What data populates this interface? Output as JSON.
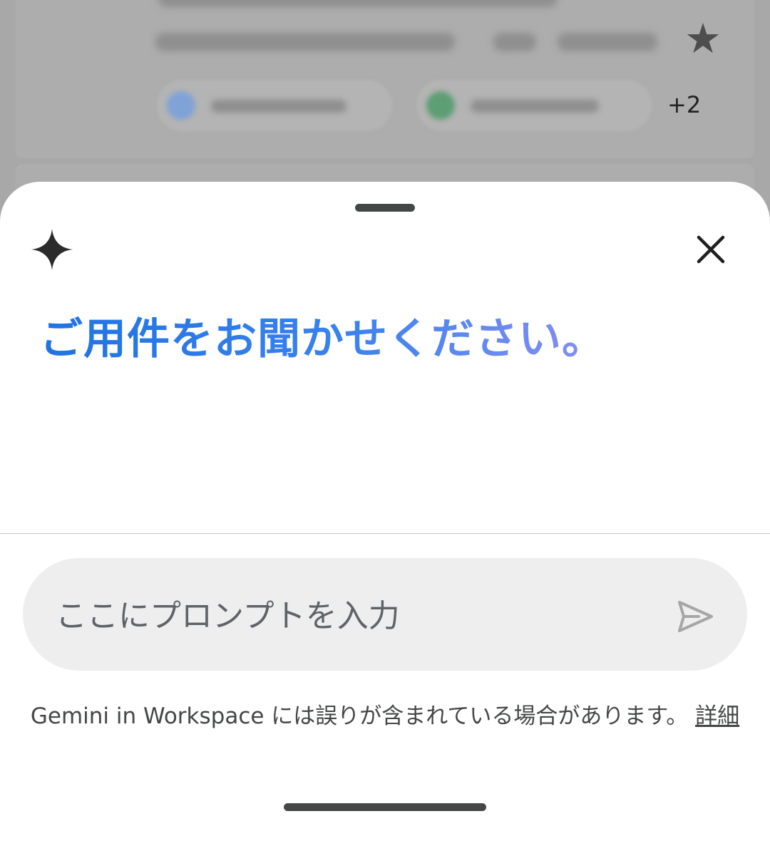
{
  "background": {
    "more_recipients": "+2"
  },
  "sheet": {
    "greeting": "ご用件をお聞かせください。",
    "prompt": {
      "placeholder": "ここにプロンプトを入力",
      "value": ""
    },
    "disclaimer": {
      "text": "Gemini in Workspace には誤りが含まれている場合があります。",
      "link": "詳細"
    }
  },
  "icons": {
    "brand": "sparkle-icon",
    "close": "close-icon",
    "send": "send-icon",
    "star": "star-icon"
  },
  "colors": {
    "greeting_start": "#1e73e3",
    "greeting_end": "#8a8ff3",
    "scrim": "#a8a8a8",
    "input_bg": "#eeeeee"
  }
}
